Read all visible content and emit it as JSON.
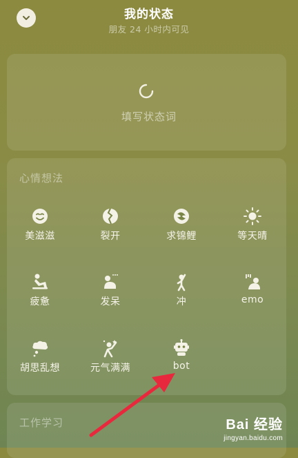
{
  "header": {
    "title": "我的状态",
    "subtitle": "朋友 24 小时内可见",
    "back_icon": "chevron-down-icon"
  },
  "status": {
    "placeholder": "填写状态词",
    "icon": "spinner-icon"
  },
  "mood_section": {
    "title": "心情想法",
    "items": [
      {
        "label": "美滋滋",
        "icon": "smile-icon"
      },
      {
        "label": "裂开",
        "icon": "cracked-icon"
      },
      {
        "label": "求锦鲤",
        "icon": "koi-icon"
      },
      {
        "label": "等天晴",
        "icon": "sun-icon"
      },
      {
        "label": "疲惫",
        "icon": "tired-icon"
      },
      {
        "label": "发呆",
        "icon": "daze-icon"
      },
      {
        "label": "冲",
        "icon": "rush-icon"
      },
      {
        "label": "emo",
        "icon": "emo-icon"
      },
      {
        "label": "胡思乱想",
        "icon": "thought-cloud-icon"
      },
      {
        "label": "元气满满",
        "icon": "energetic-icon"
      },
      {
        "label": "bot",
        "icon": "robot-icon"
      }
    ]
  },
  "work_section": {
    "title": "工作学习"
  },
  "watermark": {
    "brand": "Bai 经验",
    "url": "jingyan.baidu.com"
  },
  "colors": {
    "annotation_arrow": "#e8283c",
    "background_top": "#8c8a3f",
    "background_bottom": "#6e8553"
  }
}
